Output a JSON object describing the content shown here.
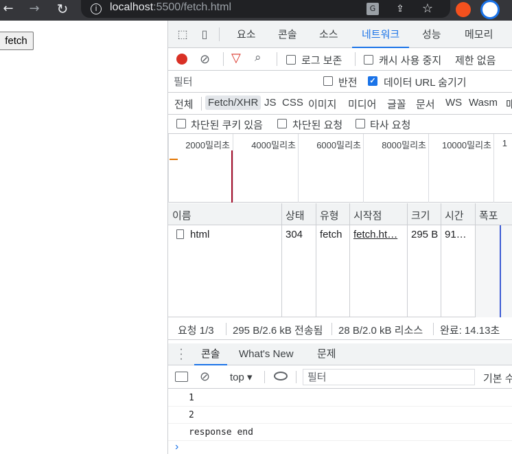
{
  "browser": {
    "url_host": "localhost",
    "url_rest": ":5500/fetch.html",
    "back_glyph": "←",
    "forward_glyph": "→",
    "reload_glyph": "↻"
  },
  "page": {
    "fetch_button_label": "fetch"
  },
  "devtools": {
    "tabs": [
      "요소",
      "콘솔",
      "소스",
      "네트워크",
      "성능",
      "메모리"
    ],
    "active_tab": "네트워크",
    "toolbar": {
      "preserve_log": "로그 보존",
      "disable_cache": "캐시 사용 중지",
      "throttle": "제한 없음"
    },
    "filter": {
      "placeholder": "필터",
      "invert": "반전",
      "hide_data_urls": "데이터 URL 숨기기"
    },
    "type_filters": [
      "전체",
      "Fetch/XHR",
      "JS",
      "CSS",
      "이미지",
      "미디어",
      "글꼴",
      "문서",
      "WS",
      "Wasm",
      "매"
    ],
    "active_type": "Fetch/XHR",
    "blocked": {
      "blocked_cookies": "차단된 쿠키 있음",
      "blocked_requests": "차단된 요청",
      "third_party": "타사 요청"
    },
    "timeline_ticks": [
      "2000밀리초",
      "4000밀리초",
      "6000밀리초",
      "8000밀리초",
      "10000밀리초",
      "1"
    ],
    "table": {
      "headers": [
        "이름",
        "상태",
        "유형",
        "시작점",
        "크기",
        "시간",
        "폭포"
      ],
      "rows": [
        {
          "name": "html",
          "status": "304",
          "type": "fetch",
          "initiator": "fetch.ht…",
          "size": "295 B",
          "time": "91…"
        }
      ]
    },
    "summary": {
      "requests": "요청 1/3",
      "transferred": "295 B/2.6 kB 전송됨",
      "resources": "28 B/2.0 kB 리소스",
      "finish": "완료: 14.13초"
    },
    "drawer": {
      "tabs": [
        "콘솔",
        "What's New",
        "문제"
      ],
      "active": "콘솔",
      "context": "top",
      "filter_placeholder": "필터",
      "levels": "기본 수"
    },
    "console_lines": [
      "1",
      "2",
      "response end"
    ],
    "prompt": "›"
  }
}
